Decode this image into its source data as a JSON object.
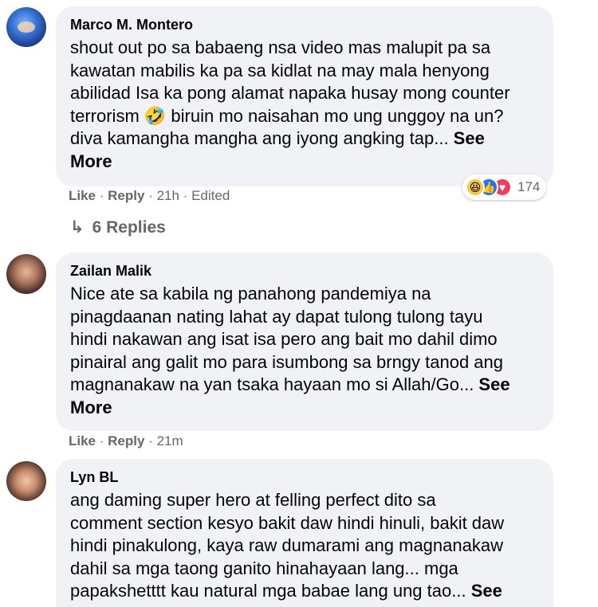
{
  "comments": [
    {
      "author": "Marco M. Montero",
      "text": "shout out po sa babaeng nsa video mas malupit pa sa\nkawatan mabilis ka pa sa kidlat na may mala henyong\nabilidad Isa ka pong alamat napaka husay mong counter\nterrorism 🤣 biruin mo naisahan mo ung unggoy na un?\ndiva kamangha mangha ang iyong angking tap... ",
      "see_more": "See\nMore",
      "like": "Like",
      "reply": "Reply",
      "time": "21h",
      "edited": "Edited",
      "reaction_count": "174",
      "replies": "6 Replies"
    },
    {
      "author": "Zailan Malik",
      "text": "Nice ate sa kabila ng panahong pandemiya na\npinagdaanan nating lahat ay dapat tulong tulong tayu\nhindi nakawan ang isat isa pero ang bait mo dahil dimo\npinairal ang galit mo para isumbong sa brngy tanod ang\nmagnanakaw na yan tsaka hayaan mo si Allah/Go... ",
      "see_more": "See\nMore",
      "like": "Like",
      "reply": "Reply",
      "time": "21m"
    },
    {
      "author": "Lyn BL",
      "text": "ang daming super hero at felling perfect dito sa\ncomment section kesyo bakit daw hindi hinuli, bakit daw\nhindi pinakulong, kaya raw dumarami ang magnanakaw\ndahil sa mga taong ganito hinahayaan lang... mga\npapakshetttt kau natural mga babae lang ung tao... ",
      "see_more": "See"
    }
  ],
  "icons": {
    "reply_arrow": "↳",
    "haha": "😆",
    "like": "👍",
    "love": "♥"
  }
}
